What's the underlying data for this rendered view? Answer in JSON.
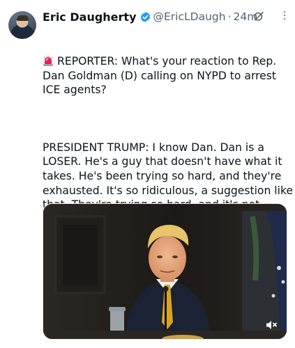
{
  "tweet": {
    "author_name": "Eric Daugherty",
    "handle": "@EricLDaugh",
    "separator": "·",
    "time": "24m",
    "paragraph1": "REPORTER: What's your reaction to Rep. Dan Goldman (D) calling on NYPD to arrest ICE agents?",
    "paragraph2": "PRESIDENT TRUMP: I know Dan. Dan is a LOSER. He's a guy that doesn't have what it takes. He's been trying so hard, and they're exhausted. It's so ridiculous, a suggestion like that. They're trying so hard, and it's not working. They've even started imitating ME, using foul language - but they use too much! You can't use the F word 7 times in one sentence!"
  },
  "icons": {
    "verified": "verified-badge-icon",
    "grok": "grok-icon",
    "more": "more-icon",
    "siren": "siren-emoji",
    "laugh": "rofl-emoji",
    "mute": "volume-muted-icon"
  },
  "colors": {
    "verified": "#1d9bf0",
    "secondary_text": "#536471"
  },
  "media": {
    "type": "video"
  }
}
